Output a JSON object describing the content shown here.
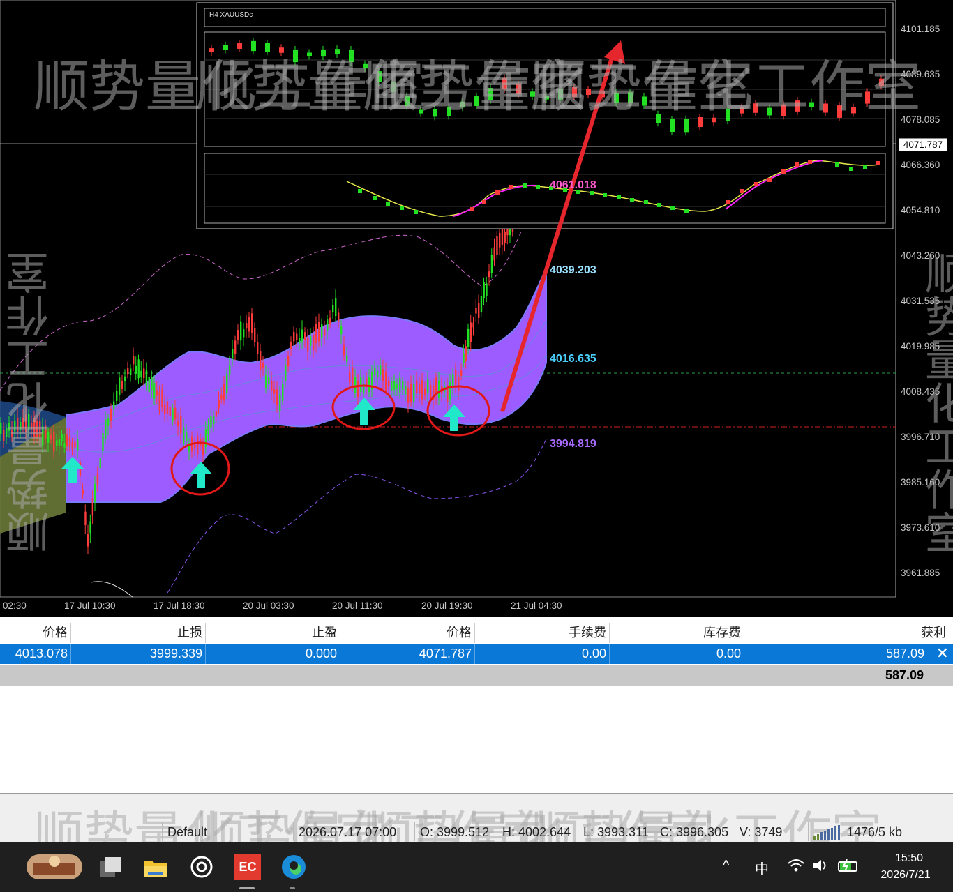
{
  "chart": {
    "symbol_label": "H4  XAUUSDc",
    "price_axis": [
      "4101.185",
      "4089.635",
      "4078.085",
      "4066.360",
      "4054.810",
      "4043.260",
      "4031.535",
      "4019.985",
      "4008.435",
      "3996.710",
      "3985.160",
      "3973.610",
      "3961.885"
    ],
    "current_price": "4071.787",
    "time_axis": [
      "02:30",
      "17 Jul 10:30",
      "17 Jul 18:30",
      "20 Jul 03:30",
      "20 Jul 11:30",
      "20 Jul 19:30",
      "21 Jul 04:30"
    ],
    "indicator_labels": {
      "magenta": "4061.018",
      "upper_band": "4039.203",
      "mid_band": "4016.635",
      "lower_band": "3994.819"
    },
    "colors": {
      "bull": "#22e022",
      "bear": "#ff3c3c",
      "band_fill": "#9c5cff",
      "arrow": "#20e8c8",
      "circle": "#e01818",
      "trend_arrow": "#e6262d"
    },
    "watermark": "顺势量化工作室"
  },
  "trade_table": {
    "headers": [
      "价格",
      "止损",
      "止盈",
      "价格",
      "手续费",
      "库存费",
      "获利"
    ],
    "row": [
      "4013.078",
      "3999.339",
      "0.000",
      "4071.787",
      "0.00",
      "0.00",
      "587.09"
    ],
    "total": "587.09"
  },
  "status_bar": {
    "profile": "Default",
    "datetime": "2026.07.17 07:00",
    "open": "O: 3999.512",
    "high": "H: 4002.644",
    "low": "L: 3993.311",
    "close": "C: 3996.305",
    "volume": "V: 3749",
    "traffic": "1476/5 kb"
  },
  "taskbar": {
    "ime": "中",
    "time": "15:50",
    "date": "2026/7/21",
    "apps": [
      "landscape-app-icon",
      "task-view-icon",
      "file-explorer-icon",
      "chatgpt-icon",
      "ec-app-icon",
      "edge-icon"
    ]
  }
}
